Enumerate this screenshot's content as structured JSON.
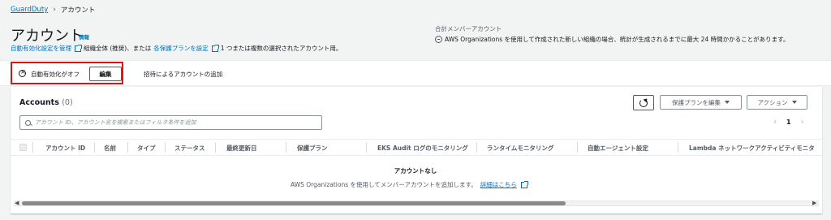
{
  "breadcrumb": {
    "root": "GuardDuty",
    "current": "アカウント"
  },
  "header": {
    "title": "アカウント",
    "info_link": "情報",
    "desc_link_auto": "自動有効化設定を管理",
    "desc_text_1": "組織全体 (推奨)、または",
    "desc_link_plans": "各保護プランを設定",
    "desc_text_2": "1 つまたは複数の選択されたアカウント用。"
  },
  "member_summary": {
    "label": "合計メンバーアカウント",
    "note": "AWS Organizations を使用して作成された新しい組織の場合、統計が生成されるまでに最大 24 時間かかることがあります。"
  },
  "settings_bar": {
    "auto_enable_status": "自動有効化がオフ",
    "edit_button": "編集",
    "invite_link": "招待によるアカウントの追加"
  },
  "accounts_panel": {
    "title": "Accounts",
    "count": "(0)",
    "plan_button": "保護プランを編集",
    "action_button": "アクション",
    "search_placeholder": "アカウント ID、アカウント名を検索またはフィルタ条件を追加",
    "search_value": "",
    "page_current": "1",
    "columns": [
      "アカウント ID",
      "名前",
      "タイプ",
      "ステータス",
      "最終更新日",
      "保護プラン",
      "EKS Audit ログのモニタリング",
      "ランタイムモニタリング",
      "自動エージェント設定",
      "Lambda ネットワークアクティビティモニタ"
    ],
    "empty_title": "アカウントなし",
    "empty_desc": "AWS Organizations を使用してメンバーアカウントを追加します。",
    "empty_link": "詳細はこちら"
  },
  "colors": {
    "link": "#0073bb",
    "highlight_box": "#d91515",
    "background": "#f2f3f3"
  }
}
